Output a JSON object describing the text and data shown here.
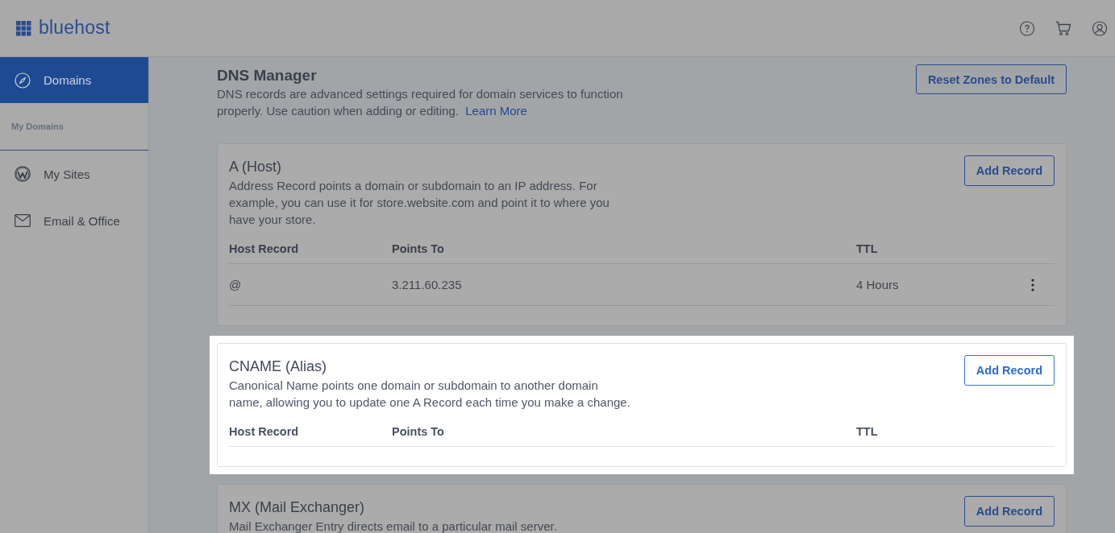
{
  "header": {
    "logo": "bluehost"
  },
  "sidebar": {
    "items": [
      {
        "kind": "nav",
        "label": "Domains",
        "selected": true
      },
      {
        "kind": "subheading",
        "label": "My Domains"
      },
      {
        "kind": "nav",
        "label": "My Sites",
        "selected": false
      },
      {
        "kind": "nav",
        "label": "Email & Office",
        "selected": false
      }
    ]
  },
  "page": {
    "title": "DNS Manager",
    "description": "DNS records are advanced settings required for domain services to function properly. Use caution when adding or editing.",
    "link": "Learn More",
    "button": "Reset Zones to Default"
  },
  "sections": [
    {
      "title": "A (Host)",
      "description": "Address Record points a domain or subdomain to an IP address. For example, you can use it for store.website.com and point it to where you have your store.",
      "button": "Add Record",
      "highlighted": false,
      "columns": [
        "Host Record",
        "Points To",
        "TTL"
      ],
      "rows": [
        {
          "cells": [
            "@",
            "3.211.60.235",
            "4 Hours"
          ]
        }
      ]
    },
    {
      "title": "CNAME (Alias)",
      "description": "Canonical Name points one domain or subdomain to another domain name, allowing you to update one A Record each time you make a change.",
      "button": "Add Record",
      "highlighted": true,
      "columns": [
        "Host Record",
        "Points To",
        "TTL"
      ]
    },
    {
      "title": "MX (Mail Exchanger)",
      "description": "Mail Exchanger Entry directs email to a particular mail server.",
      "button": "Add Record",
      "highlighted": false
    }
  ]
}
